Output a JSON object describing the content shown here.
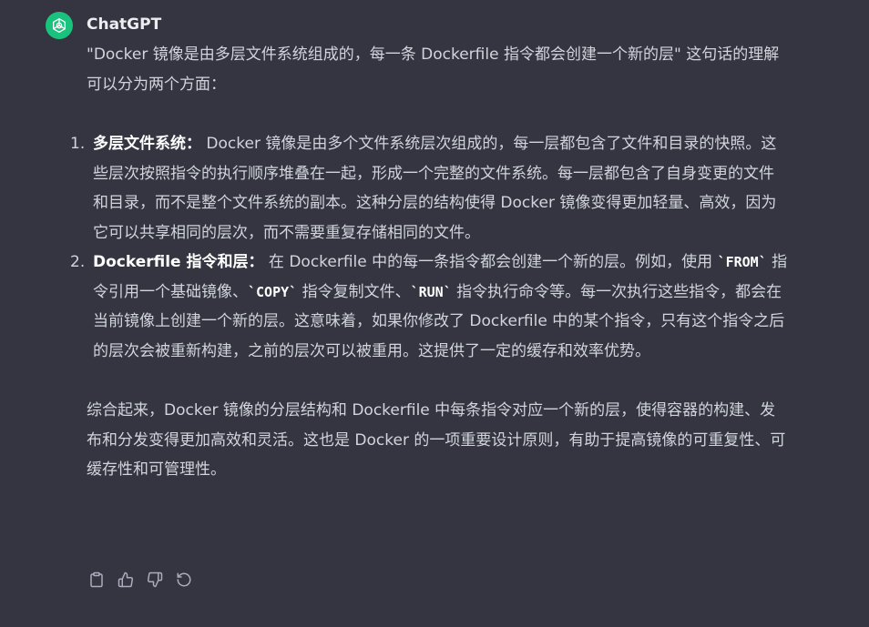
{
  "message": {
    "author": "ChatGPT",
    "intro": "\"Docker 镜像是由多层文件系统组成的，每一条 Dockerfile 指令都会创建一个新的层\" 这句话的理解可以分为两个方面：",
    "points": [
      {
        "num": "1.",
        "title": "多层文件系统：",
        "body": "Docker 镜像是由多个文件系统层次组成的，每一层都包含了文件和目录的快照。这些层次按照指令的执行顺序堆叠在一起，形成一个完整的文件系统。每一层都包含了自身变更的文件和目录，而不是整个文件系统的副本。这种分层的结构使得 Docker 镜像变得更加轻量、高效，因为它可以共享相同的层次，而不需要重复存储相同的文件。"
      },
      {
        "num": "2.",
        "title": "Dockerfile 指令和层：",
        "body_a": "在 Dockerfile 中的每一条指令都会创建一个新的层。例如，使用 ",
        "code1": "`FROM`",
        "body_b": " 指令引用一个基础镜像、",
        "code2": "`COPY`",
        "body_c": " 指令复制文件、",
        "code3": "`RUN`",
        "body_d": " 指令执行命令等。每一次执行这些指令，都会在当前镜像上创建一个新的层。这意味着，如果你修改了 Dockerfile 中的某个指令，只有这个指令之后的层次会被重新构建，之前的层次可以被重用。这提供了一定的缓存和效率优势。"
      }
    ],
    "summary": "综合起来，Docker 镜像的分层结构和 Dockerfile 中每条指令对应一个新的层，使得容器的构建、发布和分发变得更加高效和灵活。这也是 Docker 的一项重要设计原则，有助于提高镜像的可重复性、可缓存性和可管理性。"
  },
  "actions": [
    "copy-icon",
    "thumbs-up-icon",
    "thumbs-down-icon",
    "regenerate-icon"
  ],
  "colors": {
    "background": "#343541",
    "text": "#d1d5db",
    "avatar": "#19c37d"
  }
}
